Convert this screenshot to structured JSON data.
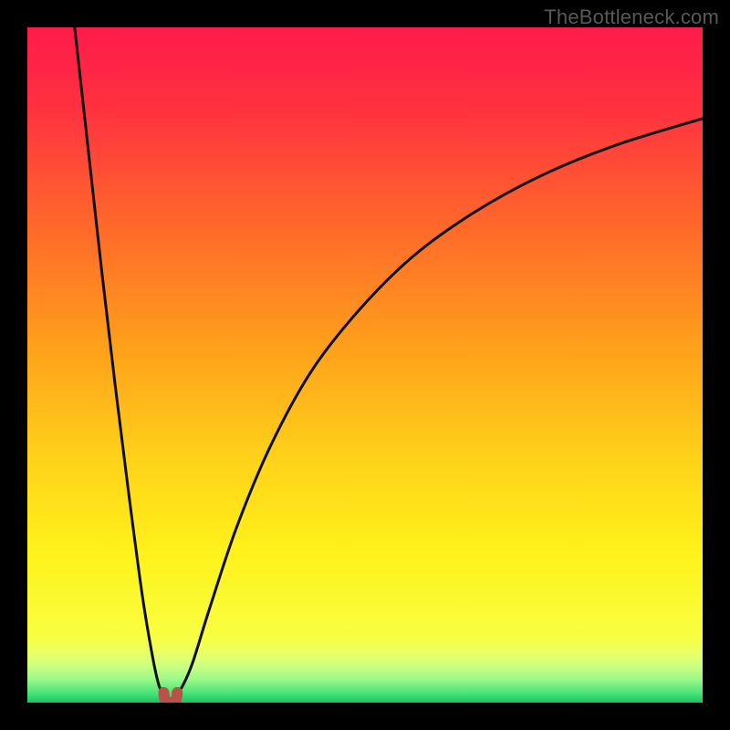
{
  "watermark": "TheBottleneck.com",
  "chart_data": {
    "type": "line",
    "title": "",
    "xlabel": "",
    "ylabel": "",
    "xlim": [
      0,
      100
    ],
    "ylim": [
      0,
      100
    ],
    "grid": false,
    "series": [
      {
        "name": "curve-left",
        "x": [
          7,
          9,
          11,
          13,
          15,
          17,
          18.5,
          19.5,
          20.2
        ],
        "y": [
          100,
          82,
          64,
          47,
          31,
          16,
          7,
          2.5,
          1.5
        ]
      },
      {
        "name": "curve-right",
        "x": [
          22.2,
          23,
          24.5,
          27,
          31,
          36,
          42,
          49,
          57,
          66,
          76,
          87,
          100
        ],
        "y": [
          1.5,
          2.5,
          6,
          14,
          26,
          38,
          49,
          58,
          66,
          72.5,
          78,
          82.5,
          86.5
        ]
      },
      {
        "name": "marker-u",
        "x": [
          20.2,
          20.4,
          21.2,
          22.0,
          22.2
        ],
        "y": [
          1.5,
          0.4,
          0.0,
          0.4,
          1.5
        ]
      }
    ],
    "background_gradient": {
      "stops": [
        {
          "offset": 0.0,
          "color": "#ff1a4b"
        },
        {
          "offset": 0.12,
          "color": "#ff3140"
        },
        {
          "offset": 0.3,
          "color": "#ff6a2a"
        },
        {
          "offset": 0.48,
          "color": "#ffa21a"
        },
        {
          "offset": 0.64,
          "color": "#ffd21a"
        },
        {
          "offset": 0.78,
          "color": "#fff21a"
        },
        {
          "offset": 0.905,
          "color": "#f8ff42"
        },
        {
          "offset": 0.925,
          "color": "#eaff66"
        },
        {
          "offset": 0.945,
          "color": "#ccff80"
        },
        {
          "offset": 0.965,
          "color": "#9cf988"
        },
        {
          "offset": 0.985,
          "color": "#4de57a"
        },
        {
          "offset": 1.0,
          "color": "#18c45e"
        }
      ]
    },
    "curve_stroke": "#0e0e0e",
    "marker_stroke": "#b9534a"
  }
}
